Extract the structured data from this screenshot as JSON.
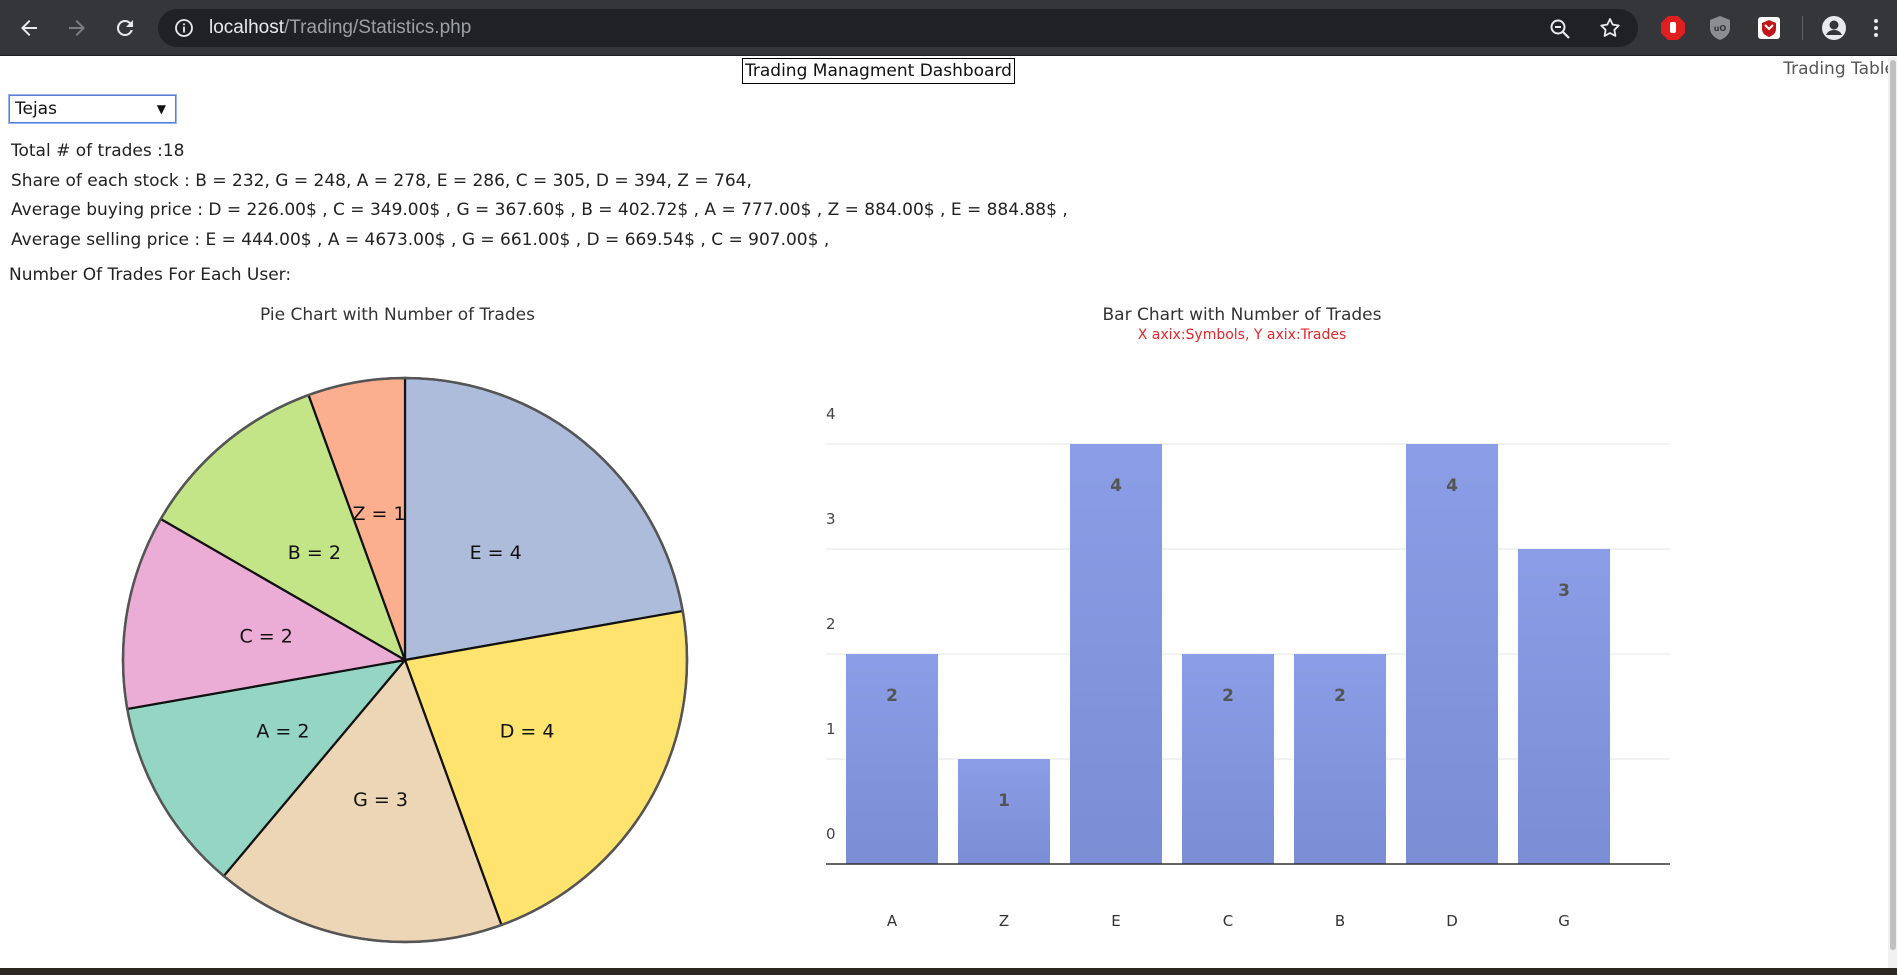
{
  "browser": {
    "url_host": "localhost",
    "url_path": "/Trading/Statistics.php"
  },
  "page": {
    "title": "Trading Managment Dashboard",
    "nav_link": "Trading Table",
    "user_select": {
      "value": "Tejas"
    },
    "stats": [
      "Total # of trades :18",
      "Share of each stock : B = 232, G = 248, A = 278, E = 286, C = 305, D = 394, Z = 764,",
      "Average buying price : D = 226.00$ , C = 349.00$ , G = 367.60$ , B = 402.72$ , A = 777.00$ , Z = 884.00$ , E = 884.88$ ,",
      "Average selling price : E = 444.00$ , A = 4673.00$ , G = 661.00$ , D = 669.54$ , C = 907.00$ ,"
    ],
    "trades_heading": "Number Of Trades For Each User:"
  },
  "chart_data": [
    {
      "type": "pie",
      "title": "Pie Chart with Number of Trades",
      "slices": [
        {
          "label": "E = 4",
          "value": 4,
          "color": "#aebcdc"
        },
        {
          "label": "D = 4",
          "value": 4,
          "color": "#fee36e"
        },
        {
          "label": "G = 3",
          "value": 3,
          "color": "#ecd6b5"
        },
        {
          "label": "A = 2",
          "value": 2,
          "color": "#94d5c3"
        },
        {
          "label": "C = 2",
          "value": 2,
          "color": "#ebadd6"
        },
        {
          "label": "B = 2",
          "value": 2,
          "color": "#c3e487"
        },
        {
          "label": "Z = 1",
          "value": 1,
          "color": "#fcaf8f"
        }
      ]
    },
    {
      "type": "bar",
      "title": "Bar Chart with Number of Trades",
      "subtitle": "X axix:Symbols, Y axix:Trades",
      "categories": [
        "A",
        "Z",
        "E",
        "C",
        "B",
        "D",
        "G"
      ],
      "values": [
        2,
        1,
        4,
        2,
        2,
        4,
        3
      ],
      "ylim": [
        0,
        4
      ],
      "yticks": [
        0,
        1,
        2,
        3,
        4
      ],
      "grid": true,
      "bar_color": "#8a9de6"
    }
  ]
}
